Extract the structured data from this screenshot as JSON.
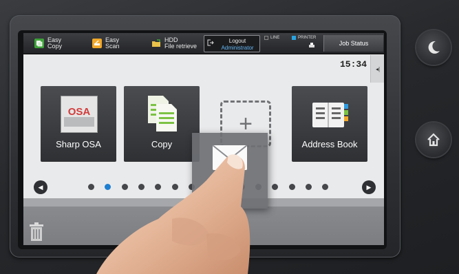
{
  "topbar": {
    "easy_copy": {
      "line1": "Easy",
      "line2": "Copy"
    },
    "easy_scan": {
      "line1": "Easy",
      "line2": "Scan"
    },
    "hdd": {
      "line1": "HDD",
      "line2": "File retrieve"
    },
    "logout": {
      "line1": "Logout",
      "line2": "Administrator"
    },
    "line_label": "LINE",
    "printer_label": "PRINTER",
    "job_status": "Job Status"
  },
  "clock": "15:34",
  "tiles": [
    {
      "label": "Sharp OSA",
      "art_text": "OSA"
    },
    {
      "label": "Copy"
    },
    {
      "label": "Address Book"
    }
  ],
  "dragged_tile": {
    "label": "Mail"
  },
  "pager": {
    "total_dots": 15,
    "active_index": 1
  },
  "icons": {
    "prev": "arrow-left-icon",
    "next": "arrow-right-icon",
    "trash": "trash-icon",
    "sleep": "moon-icon",
    "home": "home-icon"
  },
  "colors": {
    "accent_blue": "#1f7fd1",
    "admin_text": "#63b4f2",
    "easy_copy_icon": "#3fa23a",
    "easy_scan_icon": "#f2a92a",
    "hdd_icon": "#e9c24a"
  }
}
